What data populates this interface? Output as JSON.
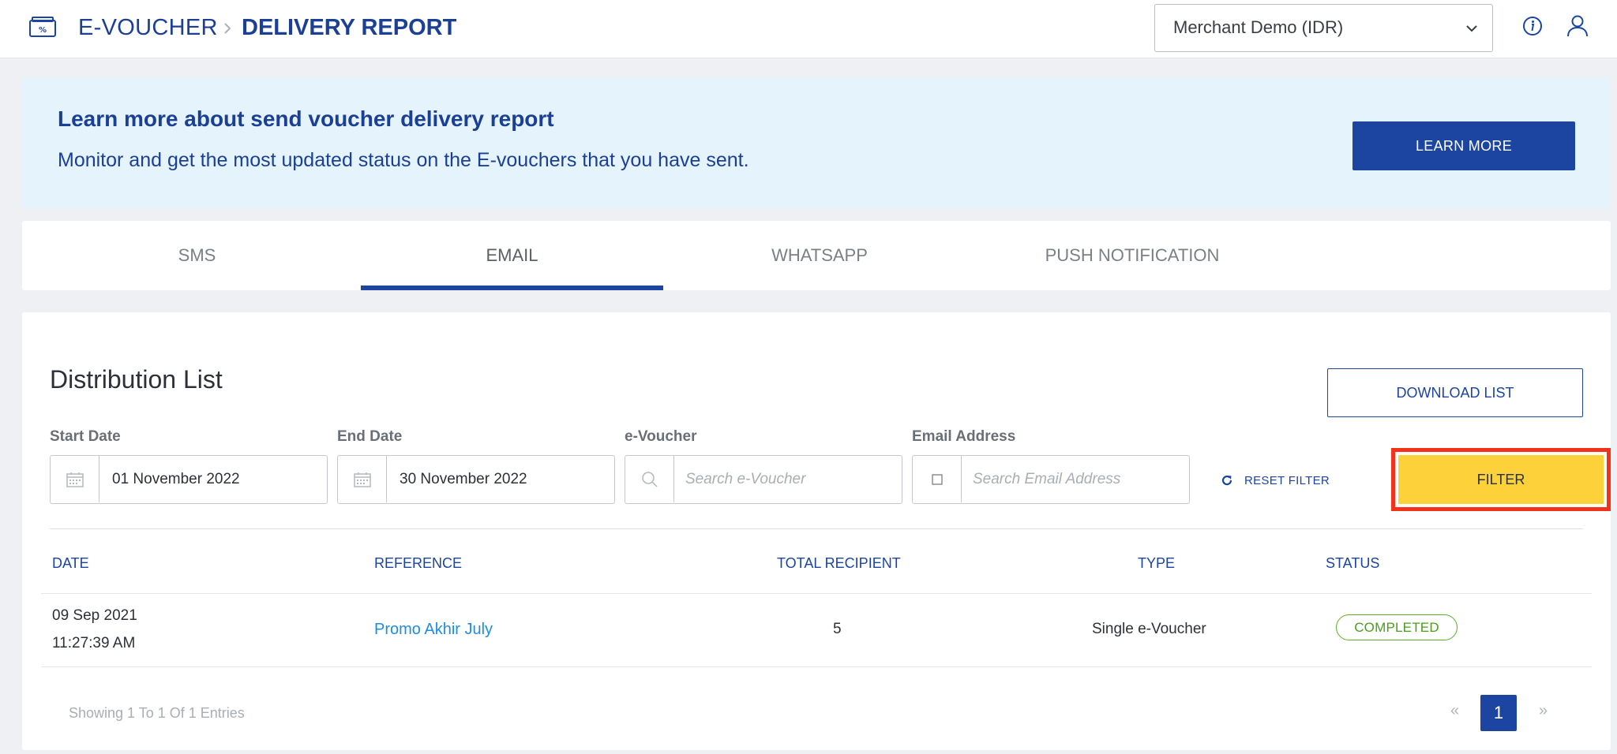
{
  "header": {
    "root_label": "E-VOUCHER",
    "current_label": "DELIVERY REPORT",
    "merchant": "Merchant Demo (IDR)"
  },
  "banner": {
    "title": "Learn more about send voucher delivery report",
    "subtitle": "Monitor and get the most updated status on the E-vouchers that you have sent.",
    "button": "LEARN MORE"
  },
  "tabs": [
    {
      "label": "SMS",
      "active": false
    },
    {
      "label": "EMAIL",
      "active": true
    },
    {
      "label": "WHATSAPP",
      "active": false
    },
    {
      "label": "PUSH NOTIFICATION",
      "active": false
    }
  ],
  "panel": {
    "title": "Distribution List",
    "download_button": "DOWNLOAD LIST"
  },
  "filters": {
    "start_date": {
      "label": "Start Date",
      "value": "01 November 2022"
    },
    "end_date": {
      "label": "End Date",
      "value": "30 November 2022"
    },
    "evoucher": {
      "label": "e-Voucher",
      "placeholder": "Search e-Voucher"
    },
    "email": {
      "label": "Email Address",
      "placeholder": "Search Email Address"
    },
    "reset": "RESET FILTER",
    "filter_button": "FILTER"
  },
  "table": {
    "headers": [
      "DATE",
      "REFERENCE",
      "TOTAL RECIPIENT",
      "TYPE",
      "STATUS"
    ],
    "rows": [
      {
        "date": "09 Sep 2021",
        "time": "11:27:39 AM",
        "reference": "Promo Akhir July",
        "total_recipient": "5",
        "type": "Single e-Voucher",
        "status": "COMPLETED"
      }
    ]
  },
  "pagination": {
    "showing": "Showing 1 To 1 Of 1 Entries",
    "prev": "«",
    "current": "1",
    "next": "»"
  },
  "colors": {
    "brand": "#1b45a0",
    "accent_yellow": "#fdd13a",
    "highlight_red": "#f4321c",
    "status_green": "#5bae2a",
    "banner_bg": "#e5f4fc"
  }
}
